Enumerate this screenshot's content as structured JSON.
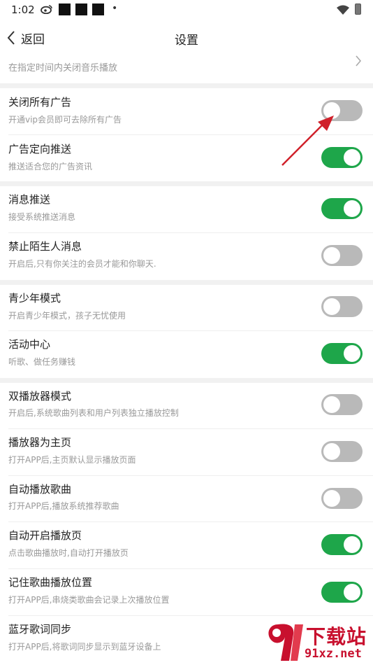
{
  "status_bar": {
    "time": "1:02",
    "extra_icon": "•"
  },
  "nav": {
    "back_label": "返回",
    "title": "设置"
  },
  "top_row": {
    "subtitle": "在指定时间内关闭音乐播放"
  },
  "settings": [
    {
      "title": "关闭所有广告",
      "subtitle": "开通vip会员即可去除所有广告",
      "enabled": false
    },
    {
      "title": "广告定向推送",
      "subtitle": "推送适合您的广告资讯",
      "enabled": true
    },
    {
      "title": "消息推送",
      "subtitle": "接受系统推送消息",
      "enabled": true
    },
    {
      "title": "禁止陌生人消息",
      "subtitle": "开启后,只有你关注的会员才能和你聊天.",
      "enabled": false
    },
    {
      "title": "青少年模式",
      "subtitle": "开启青少年模式，孩子无忧使用",
      "enabled": false
    },
    {
      "title": "活动中心",
      "subtitle": "听歌、做任务赚钱",
      "enabled": true
    },
    {
      "title": "双播放器模式",
      "subtitle": "开启后,系统歌曲列表和用户列表独立播放控制",
      "enabled": false
    },
    {
      "title": "播放器为主页",
      "subtitle": "打开APP后,主页默认显示播放页面",
      "enabled": false
    },
    {
      "title": "自动播放歌曲",
      "subtitle": "打开APP后,播放系统推荐歌曲",
      "enabled": false
    },
    {
      "title": "自动开启播放页",
      "subtitle": "点击歌曲播放时,自动打开播放页",
      "enabled": true
    },
    {
      "title": "记住歌曲播放位置",
      "subtitle": "打开APP后,串烧类歌曲会记录上次播放位置",
      "enabled": true
    },
    {
      "title": "蓝牙歌词同步",
      "subtitle": "打开APP后,将歌词同步显示到蓝牙设备上"
    }
  ],
  "watermark": {
    "brand": "下载站",
    "url": "91xz.net"
  },
  "colors": {
    "toggle_on": "#1ea64a",
    "toggle_off": "#b9b9b9",
    "annotation_arrow": "#d0202a",
    "watermark": "#c8102e"
  }
}
